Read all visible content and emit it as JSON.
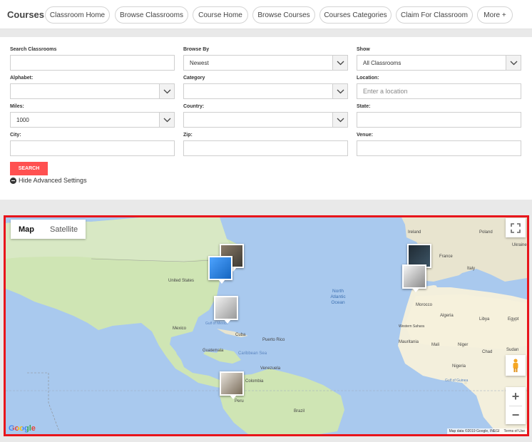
{
  "nav": {
    "brand": "Courses",
    "items": [
      "Classroom Home",
      "Browse Classrooms",
      "Course Home",
      "Browse Courses",
      "Courses Categories",
      "Claim For Classroom",
      "More +"
    ]
  },
  "form": {
    "search_classrooms_label": "Search Classrooms",
    "search_classrooms_value": "",
    "browse_by_label": "Browse By",
    "browse_by_value": "Newest",
    "show_label": "Show",
    "show_value": "All Classrooms",
    "alphabet_label": "Alphabet:",
    "alphabet_value": "",
    "category_label": "Category",
    "category_value": "",
    "location_label": "Location:",
    "location_placeholder": "Enter a location",
    "miles_label": "Miles:",
    "miles_value": "1000",
    "country_label": "Country:",
    "country_value": "",
    "state_label": "State:",
    "state_value": "",
    "city_label": "City:",
    "city_value": "",
    "zip_label": "Zip:",
    "zip_value": "",
    "venue_label": "Venue:",
    "venue_value": "",
    "search_button": "SEARCH",
    "hide_advanced": "Hide Advanced Settings"
  },
  "map": {
    "type_map": "Map",
    "type_satellite": "Satellite",
    "zoom_in": "+",
    "zoom_out": "−",
    "google": "Google",
    "attribution": "Map data ©2019 Google, INEGI",
    "terms": "Terms of Use",
    "labels": {
      "united_states": "United States",
      "mexico": "Mexico",
      "cuba": "Cuba",
      "puerto_rico": "Puerto Rico",
      "guatemala": "Guatemala",
      "caribbean_sea": "Caribbean Sea",
      "venezuela": "Venezuela",
      "colombia": "Colombia",
      "brazil": "Brazil",
      "peru": "Peru",
      "gulf_of_mexico": "Gulf of Mexico",
      "north_atlantic_ocean": "North Atlantic Ocean",
      "ireland": "Ireland",
      "poland": "Poland",
      "ukraine": "Ukraine",
      "france": "France",
      "italy": "Italy",
      "morocco": "Morocco",
      "algeria": "Algeria",
      "libya": "Libya",
      "egypt": "Egypt",
      "western_sahara": "Western Sahara",
      "mauritania": "Mauritania",
      "mali": "Mali",
      "niger": "Niger",
      "chad": "Chad",
      "sudan": "Sudan",
      "nigeria": "Nigeria",
      "gulf_of_guinea": "Gulf of Guinea"
    }
  }
}
